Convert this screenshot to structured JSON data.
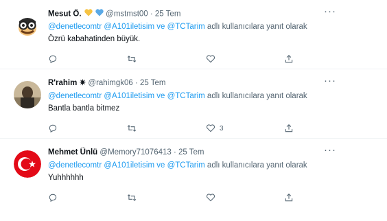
{
  "tweets": [
    {
      "name": "Mesut Ö.",
      "handle": "@mstmst00 · 25 Tem",
      "reply_prefix": "",
      "mentions": [
        "@denetlecomtr",
        "@A101iletisim",
        "@TCTarim"
      ],
      "reply_and": "ve",
      "reply_suffix": "adlı kullanıcılara yanıt olarak",
      "text": "Özrü kabahatinden büyük.",
      "like_count": "",
      "avatar": "glasses-face-avatar"
    },
    {
      "name": "R'rahim",
      "name_emoji": "✷",
      "handle": "@rahimgk06 · 25 Tem",
      "mentions": [
        "@denetlecomtr",
        "@A101iletisim",
        "@TCTarim"
      ],
      "reply_and": "ve",
      "reply_suffix": "adlı kullanıcılara yanıt olarak",
      "text": "Bantla bantla bitmez",
      "like_count": "3",
      "avatar": "photo-avatar"
    },
    {
      "name": "Mehmet Ünlü",
      "handle": "@Memory71076413 · 25 Tem",
      "mentions": [
        "@denetlecomtr",
        "@A101iletisim",
        "@TCTarim"
      ],
      "reply_and": "ve",
      "reply_suffix": "adlı kullanıcılara yanıt olarak",
      "text": "Yuhhhhhh",
      "like_count": "",
      "avatar": "turkish-flag-avatar"
    }
  ],
  "more_label": "···",
  "colors": {
    "link": "#1d9bf0",
    "muted": "#536471",
    "text": "#0f1419"
  }
}
